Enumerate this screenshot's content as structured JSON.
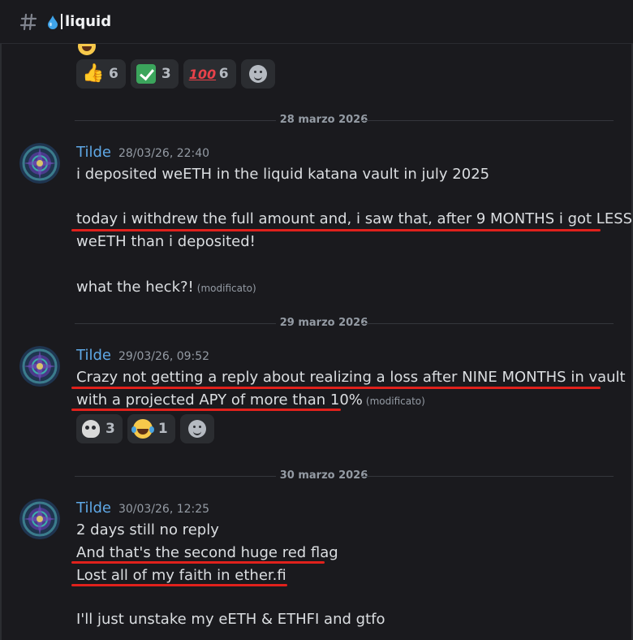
{
  "header": {
    "channel_name": "liquid",
    "hash_icon": "hash-icon",
    "channel_emoji": "droplet-icon"
  },
  "top_reactions": [
    {
      "icon": "thumbs-up-icon",
      "emoji": "👍",
      "count": "6"
    },
    {
      "icon": "check-mark-icon",
      "emoji": "✅",
      "count": "3"
    },
    {
      "icon": "hundred-points-icon",
      "emoji": "💯",
      "count": "6"
    }
  ],
  "dividers": [
    "28 marzo 2026",
    "29 marzo 2026",
    "30 marzo 2026"
  ],
  "messages": [
    {
      "author": "Tilde",
      "timestamp": "28/03/26, 22:40",
      "lines": [
        "i deposited weETH in the liquid katana vault in july 2025",
        "today i withdrew the full amount and, i saw that, after 9 MONTHS i got LESS",
        "weETH than i deposited!",
        "what the heck?!"
      ],
      "edited": "(modificato)"
    },
    {
      "author": "Tilde",
      "timestamp": "29/03/26, 09:52",
      "lines": [
        "Crazy not getting a reply about realizing a loss after NINE MONTHS in vault",
        "with a projected APY of more than 10%"
      ],
      "edited": "(modificato)",
      "reactions": [
        {
          "icon": "skull-icon",
          "emoji": "💀",
          "count": "3"
        },
        {
          "icon": "crying-laughing-icon",
          "emoji": "😂",
          "count": "1"
        }
      ]
    },
    {
      "author": "Tilde",
      "timestamp": "30/03/26, 12:25",
      "lines": [
        "2 days still no reply",
        "And that's the second huge red flag",
        "Lost all of my faith in ether.fi",
        "I'll just unstake my eETH & ETHFI and gtfo"
      ]
    }
  ],
  "colors": {
    "background": "#1a1a1e",
    "author": "#5fa8e6",
    "annotation_red": "#e0211c",
    "reaction_bg": "#2b2d31"
  }
}
